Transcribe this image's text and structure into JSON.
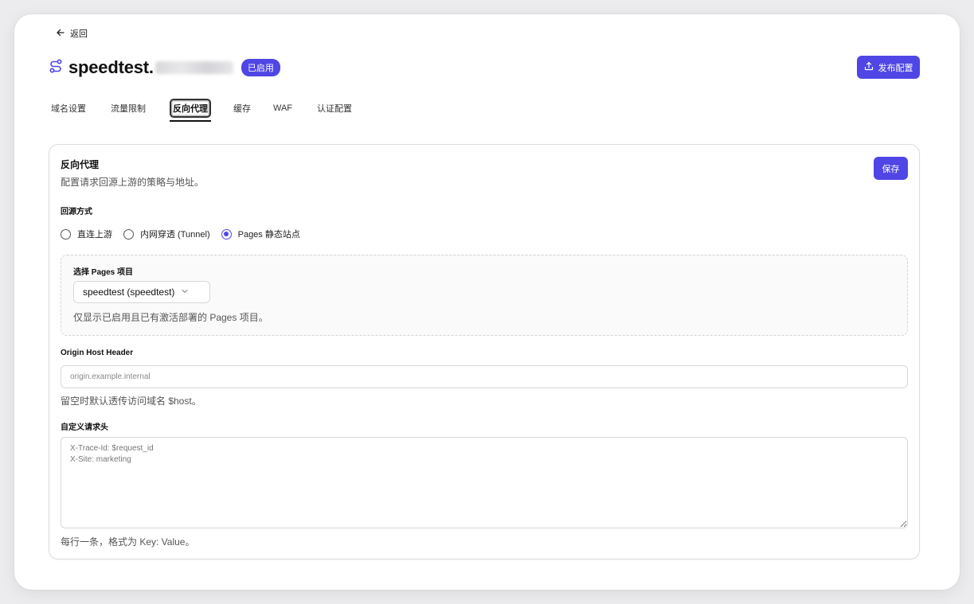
{
  "back": {
    "label": "返回",
    "icon": "arrow-left-icon"
  },
  "header": {
    "domain": "speedtest.",
    "status_badge": "已启用",
    "publish_label": "发布配置",
    "accent_color": "#4f46e5"
  },
  "tabs": [
    {
      "label": "域名设置",
      "active": false
    },
    {
      "label": "流量限制",
      "active": false
    },
    {
      "label": "反向代理",
      "active": true
    },
    {
      "label": "缓存",
      "active": false
    },
    {
      "label": "WAF",
      "active": false
    },
    {
      "label": "认证配置",
      "active": false
    }
  ],
  "card": {
    "title": "反向代理",
    "subtitle": "配置请求回源上游的策略与地址。",
    "save_label": "保存",
    "origin_mode": {
      "label": "回源方式",
      "options": [
        {
          "label": "直连上游",
          "selected": false
        },
        {
          "label": "内网穿透 (Tunnel)",
          "selected": false
        },
        {
          "label": "Pages 静态站点",
          "selected": true
        }
      ]
    },
    "pages": {
      "label": "选择 Pages 项目",
      "selected": "speedtest (speedtest)",
      "help": "仅显示已启用且已有激活部署的 Pages 项目。"
    },
    "host_header": {
      "label": "Origin Host Header",
      "value": "",
      "placeholder": "origin.example.internal",
      "help": "留空时默认透传访问域名 $host。"
    },
    "custom_headers": {
      "label": "自定义请求头",
      "value": "",
      "placeholder": "X-Trace-Id: $request_id\nX-Site: marketing",
      "help": "每行一条，格式为 Key: Value。"
    }
  }
}
